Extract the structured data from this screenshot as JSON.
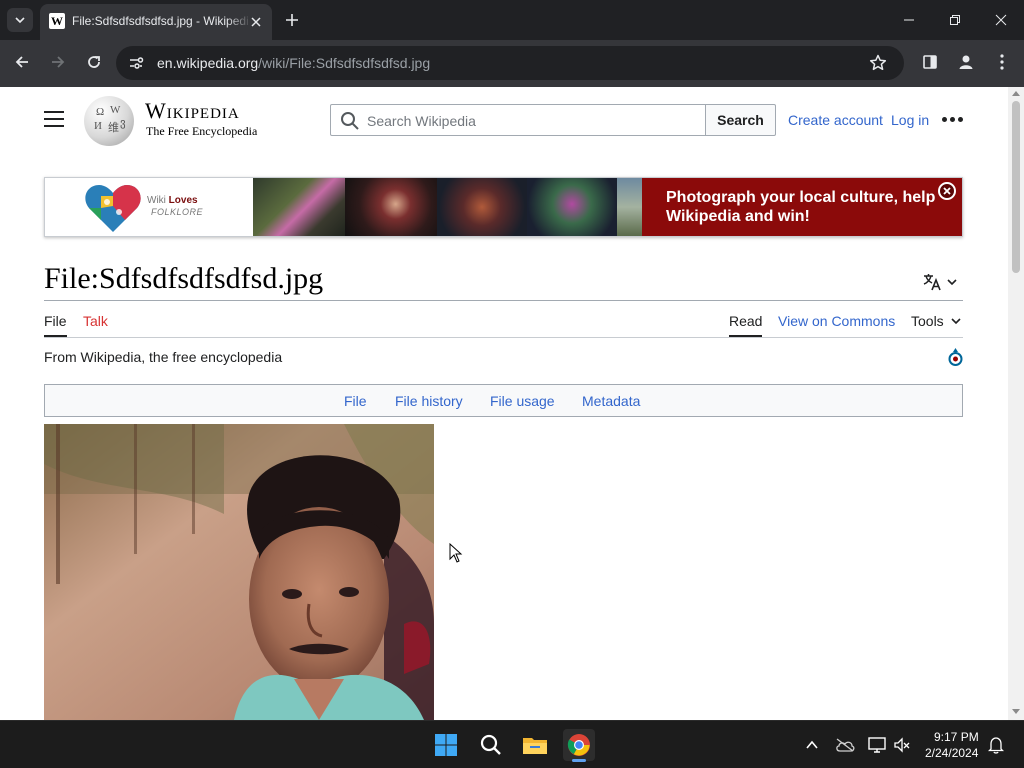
{
  "browser": {
    "tab_title": "File:Sdfsdfsdfsdfsd.jpg - Wikipedia",
    "url_host": "en.wikipedia.org",
    "url_path": "/wiki/File:Sdfsdfsdfsdfsd.jpg"
  },
  "header": {
    "wordmark": "Wikipedia",
    "tagline": "The Free Encyclopedia",
    "search_placeholder": "Search Wikipedia",
    "search_button": "Search",
    "create_account": "Create account",
    "log_in": "Log in"
  },
  "banner": {
    "logo_word1": "Wiki",
    "logo_word2": "Loves",
    "logo_word3": "FOLKLORE",
    "message": "Photograph your local culture, help Wikipedia and win!"
  },
  "page": {
    "title": "File:Sdfsdfsdfsdfsd.jpg",
    "tabs": {
      "file": "File",
      "talk": "Talk",
      "read": "Read",
      "view_on_commons": "View on Commons",
      "tools": "Tools"
    },
    "from_wikipedia": "From Wikipedia, the free encyclopedia",
    "file_nav": [
      "File",
      "File history",
      "File usage",
      "Metadata"
    ]
  },
  "taskbar": {
    "time": "9:17 PM",
    "date": "2/24/2024"
  },
  "colors": {
    "link": "#3366cc",
    "talk_link": "#d73333",
    "banner_red": "#8b0a0a",
    "chrome_dark": "#202124"
  },
  "icons": [
    "tab-list-icon",
    "wikipedia-favicon",
    "close-icon",
    "plus-icon",
    "minimize-icon",
    "restore-icon",
    "back-icon",
    "forward-icon",
    "reload-icon",
    "site-info-icon",
    "star-icon",
    "side-panel-icon",
    "profile-icon",
    "kebab-menu-icon",
    "hamburger-icon",
    "search-icon",
    "language-icon",
    "chevron-down-icon",
    "commons-icon",
    "windows-start-icon",
    "taskbar-search-icon",
    "file-explorer-icon",
    "chrome-icon",
    "chevron-up-icon",
    "onedrive-icon",
    "network-icon",
    "volume-mute-icon",
    "notification-bell-icon"
  ]
}
